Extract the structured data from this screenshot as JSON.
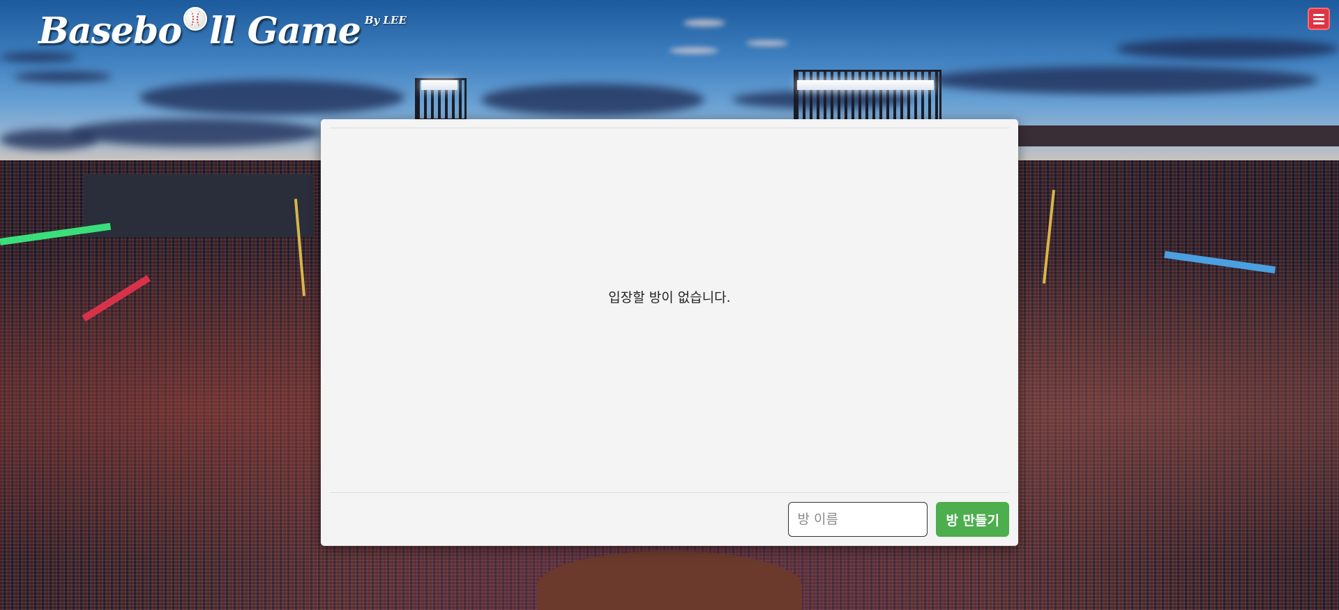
{
  "header": {
    "logo_text_1": "Basebo",
    "logo_text_2": "ll Game",
    "logo_by": "By LEE",
    "menu_icon": "hamburger-menu-icon"
  },
  "room_panel": {
    "empty_message": "입장할 방이 없습니다.",
    "room_name_placeholder": "방 이름",
    "room_name_value": "",
    "create_button_label": "방 만들기"
  },
  "colors": {
    "menu_button": "#dc3545",
    "create_button": "#4cae4c",
    "panel_background": "#f4f4f4"
  }
}
